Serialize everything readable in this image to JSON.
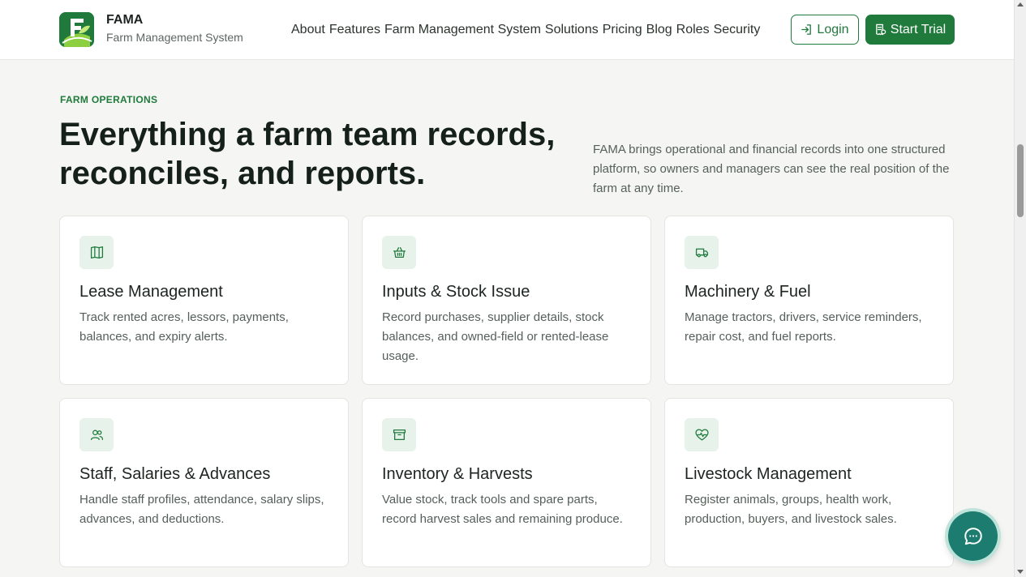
{
  "header": {
    "brand_name": "FAMA",
    "brand_sub": "Farm Management System",
    "nav": [
      "About",
      "Features",
      "Farm Management System",
      "Solutions",
      "Pricing",
      "Blog",
      "Roles",
      "Security"
    ],
    "login_label": "Login",
    "trial_label": "Start Trial"
  },
  "hero": {
    "eyebrow": "FARM OPERATIONS",
    "title_line1": "Everything a farm team records,",
    "title_line2": "reconciles, and reports.",
    "description": "FAMA brings operational and financial records into one structured platform, so owners and managers can see the real position of the farm at any time."
  },
  "cards": [
    {
      "icon": "map-icon",
      "title": "Lease Management",
      "description": "Track rented acres, lessors, payments, balances, and expiry alerts."
    },
    {
      "icon": "basket-icon",
      "title": "Inputs & Stock Issue",
      "description": "Record purchases, supplier details, stock balances, and owned-field or rented-lease usage."
    },
    {
      "icon": "truck-icon",
      "title": "Machinery & Fuel",
      "description": "Manage tractors, drivers, service reminders, repair cost, and fuel reports."
    },
    {
      "icon": "users-icon",
      "title": "Staff, Salaries & Advances",
      "description": "Handle staff profiles, attendance, salary slips, advances, and deductions."
    },
    {
      "icon": "archive-icon",
      "title": "Inventory & Harvests",
      "description": "Value stock, track tools and spare parts, record harvest sales and remaining produce."
    },
    {
      "icon": "heart-pulse-icon",
      "title": "Livestock Management",
      "description": "Register animals, groups, health work, production, buyers, and livestock sales."
    }
  ],
  "colors": {
    "brand_green": "#1f7a3c",
    "icon_bg": "#e6f2ea",
    "chat_teal": "#1b7c6f"
  }
}
